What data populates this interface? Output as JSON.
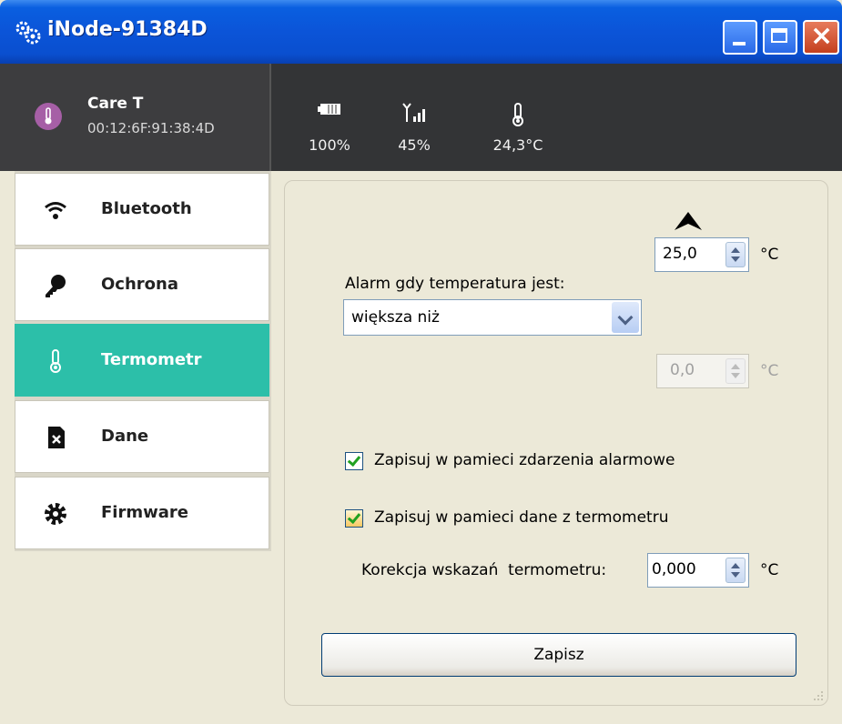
{
  "window": {
    "title": "iNode-91384D",
    "icon": "gears-icon",
    "controls": [
      "minimize-icon",
      "maximize-icon",
      "close-icon"
    ]
  },
  "header": {
    "device_name": "Care T",
    "device_mac": "00:12:6F:91:38:4D",
    "device_icon": "thermometer-icon",
    "stats": {
      "battery": {
        "icon": "battery-icon",
        "value": "100%"
      },
      "signal": {
        "icon": "signal-icon",
        "value": "45%"
      },
      "temperature": {
        "icon": "thermometer-icon",
        "value": "24,3°C"
      }
    }
  },
  "sidebar": {
    "items": [
      {
        "label": "Bluetooth",
        "icon": "wifi-icon",
        "active": false
      },
      {
        "label": "Ochrona",
        "icon": "key-icon",
        "active": false
      },
      {
        "label": "Termometr",
        "icon": "thermometer-icon",
        "active": true
      },
      {
        "label": "Dane",
        "icon": "sd-card-icon",
        "active": false
      },
      {
        "label": "Firmware",
        "icon": "gear-icon",
        "active": false
      }
    ]
  },
  "main": {
    "upper_threshold": {
      "value": "25,0",
      "unit": "°C"
    },
    "alarm_label": "Alarm gdy temperatura jest:",
    "alarm_condition": "większa niż",
    "lower_threshold": {
      "value": "0,0",
      "unit": "°C",
      "enabled": false
    },
    "checkbox_alarm_events": {
      "label": "Zapisuj w pamieci zdarzenia alarmowe",
      "checked": true
    },
    "checkbox_thermo_data": {
      "label": "Zapisuj w pamieci dane z termometru",
      "checked": true
    },
    "correction": {
      "label": "Korekcja wskazań  termometru:",
      "value": "0,000",
      "unit": "°C"
    },
    "save_label": "Zapisz"
  },
  "colors": {
    "accent": "#2cbfa9",
    "header_bg": "#333436",
    "window_bg": "#ece9d8",
    "titlebar": "#0a54d8"
  }
}
